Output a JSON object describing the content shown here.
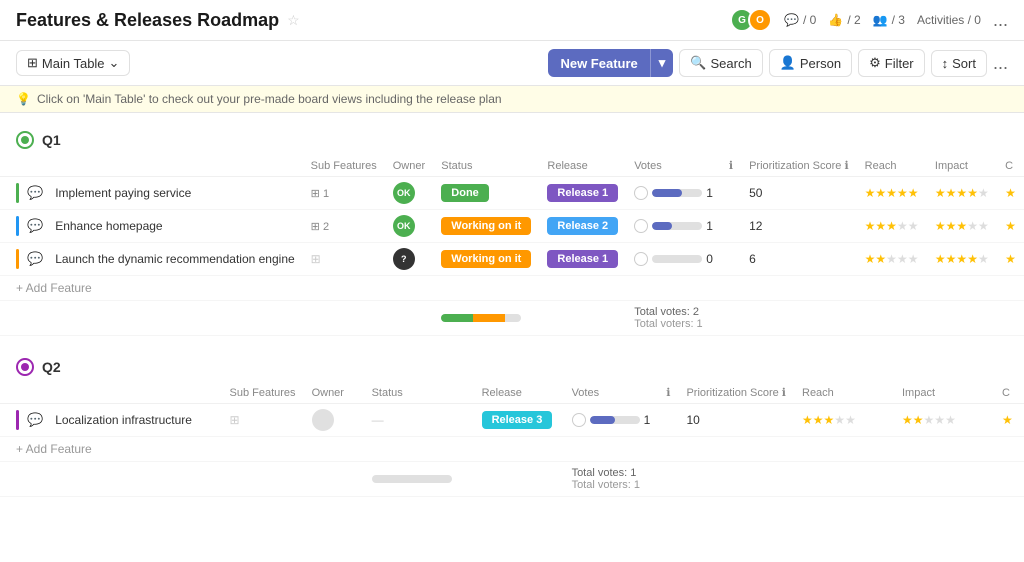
{
  "header": {
    "title": "Features & Releases Roadmap",
    "star_icon": "☆",
    "avatars": [
      {
        "initials": "G",
        "color": "green"
      },
      {
        "initials": "O",
        "color": "orange"
      }
    ],
    "stats": [
      {
        "icon": "💬",
        "value": "/ 0"
      },
      {
        "icon": "👍",
        "value": "/ 2"
      },
      {
        "icon": "👥",
        "value": "/ 3"
      },
      {
        "label": "Activities / 0"
      }
    ],
    "more": "..."
  },
  "toolbar": {
    "table_switcher_label": "Main Table",
    "table_icon": "⊞",
    "chevron": "⌄",
    "new_feature_label": "New Feature",
    "arrow_down": "▾",
    "search_label": "Search",
    "person_label": "Person",
    "filter_label": "Filter",
    "sort_label": "Sort",
    "more": "..."
  },
  "hint": {
    "icon": "💡",
    "text": "Click on 'Main Table' to check out your pre-made board views including the release plan"
  },
  "groups": [
    {
      "id": "q1",
      "label": "Q1",
      "color": "#4CAF50",
      "columns": [
        "Sub Features",
        "Owner",
        "Status",
        "Release",
        "Votes",
        "ℹ",
        "Prioritization Score",
        "Reach",
        "Impact",
        "C"
      ],
      "rows": [
        {
          "name": "Implement paying service",
          "bar_color": "bar-green",
          "has_chat": true,
          "sub_count": "1",
          "owner_initials": "OK",
          "owner_color": "ov-green",
          "status": "Done",
          "status_class": "badge-done",
          "release": "Release 1",
          "release_class": "r1",
          "votes": "1",
          "vote_pct": 60,
          "prio_score": "50",
          "reach": 5,
          "reach_filled": 5,
          "impact": 4,
          "impact_filled": 4
        },
        {
          "name": "Enhance homepage",
          "bar_color": "bar-blue",
          "has_chat": true,
          "sub_count": "2",
          "owner_initials": "OK",
          "owner_color": "ov-green",
          "status": "Working on it",
          "status_class": "badge-working",
          "release": "Release 2",
          "release_class": "r2",
          "votes": "1",
          "vote_pct": 40,
          "prio_score": "12",
          "reach": 3,
          "reach_filled": 3,
          "impact": 3,
          "impact_filled": 3
        },
        {
          "name": "Launch the dynamic recommendation engine",
          "bar_color": "bar-orange",
          "has_chat": true,
          "sub_count": null,
          "owner_initials": "?",
          "owner_color": "ov-dark",
          "status": "Working on it",
          "status_class": "badge-working",
          "release": "Release 1",
          "release_class": "r1",
          "votes": "0",
          "vote_pct": 0,
          "prio_score": "6",
          "reach": 2,
          "reach_filled": 2,
          "impact": 4,
          "impact_filled": 4
        }
      ],
      "add_label": "+ Add Feature",
      "summary_green_pct": 40,
      "summary_orange_pct": 40,
      "summary_gray_pct": 20,
      "total_votes": "Total votes: 2",
      "total_voters": "Total voters: 1"
    },
    {
      "id": "q2",
      "label": "Q2",
      "color": "#9C27B0",
      "columns": [
        "Sub Features",
        "Owner",
        "Status",
        "Release",
        "Votes",
        "ℹ",
        "Prioritization Score",
        "Reach",
        "Impact",
        "C"
      ],
      "rows": [
        {
          "name": "Localization infrastructure",
          "bar_color": "bar-purple",
          "has_chat": true,
          "sub_count": null,
          "owner_initials": "",
          "owner_color": "ov-ghost",
          "status": "",
          "status_class": "badge-gray",
          "release": "Release 3",
          "release_class": "r3",
          "votes": "1",
          "vote_pct": 50,
          "prio_score": "10",
          "reach": 3,
          "reach_filled": 3,
          "impact": 2,
          "impact_filled": 2
        }
      ],
      "add_label": "+ Add Feature",
      "summary_green_pct": 0,
      "summary_orange_pct": 0,
      "summary_gray_pct": 100,
      "total_votes": "Total votes: 1",
      "total_voters": "Total voters: 1"
    }
  ]
}
